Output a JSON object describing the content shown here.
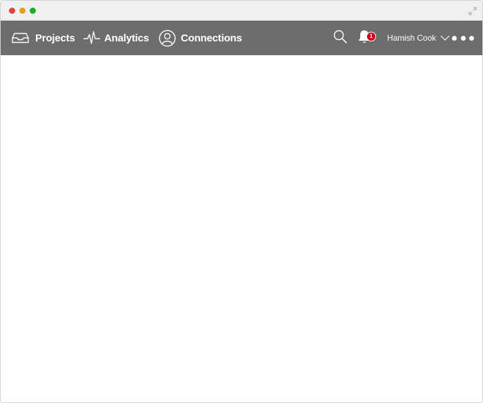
{
  "window": {
    "controls": [
      "close",
      "minimize",
      "zoom"
    ],
    "expand_icon": "expand-arrows-icon"
  },
  "navbar": {
    "background": "#6d6d6d",
    "items": [
      {
        "label": "Projects",
        "icon": "inbox-tray-icon"
      },
      {
        "label": "Analytics",
        "icon": "pulse-icon"
      },
      {
        "label": "Connections",
        "icon": "user-circle-icon"
      }
    ],
    "search_icon": "search-icon",
    "notifications": {
      "icon": "bell-icon",
      "count": "1",
      "badge_color": "#d0021b"
    },
    "user": {
      "name": "Hamish Cook",
      "icon": "chevron-down-icon"
    },
    "more_icon": "more-dots-icon"
  }
}
